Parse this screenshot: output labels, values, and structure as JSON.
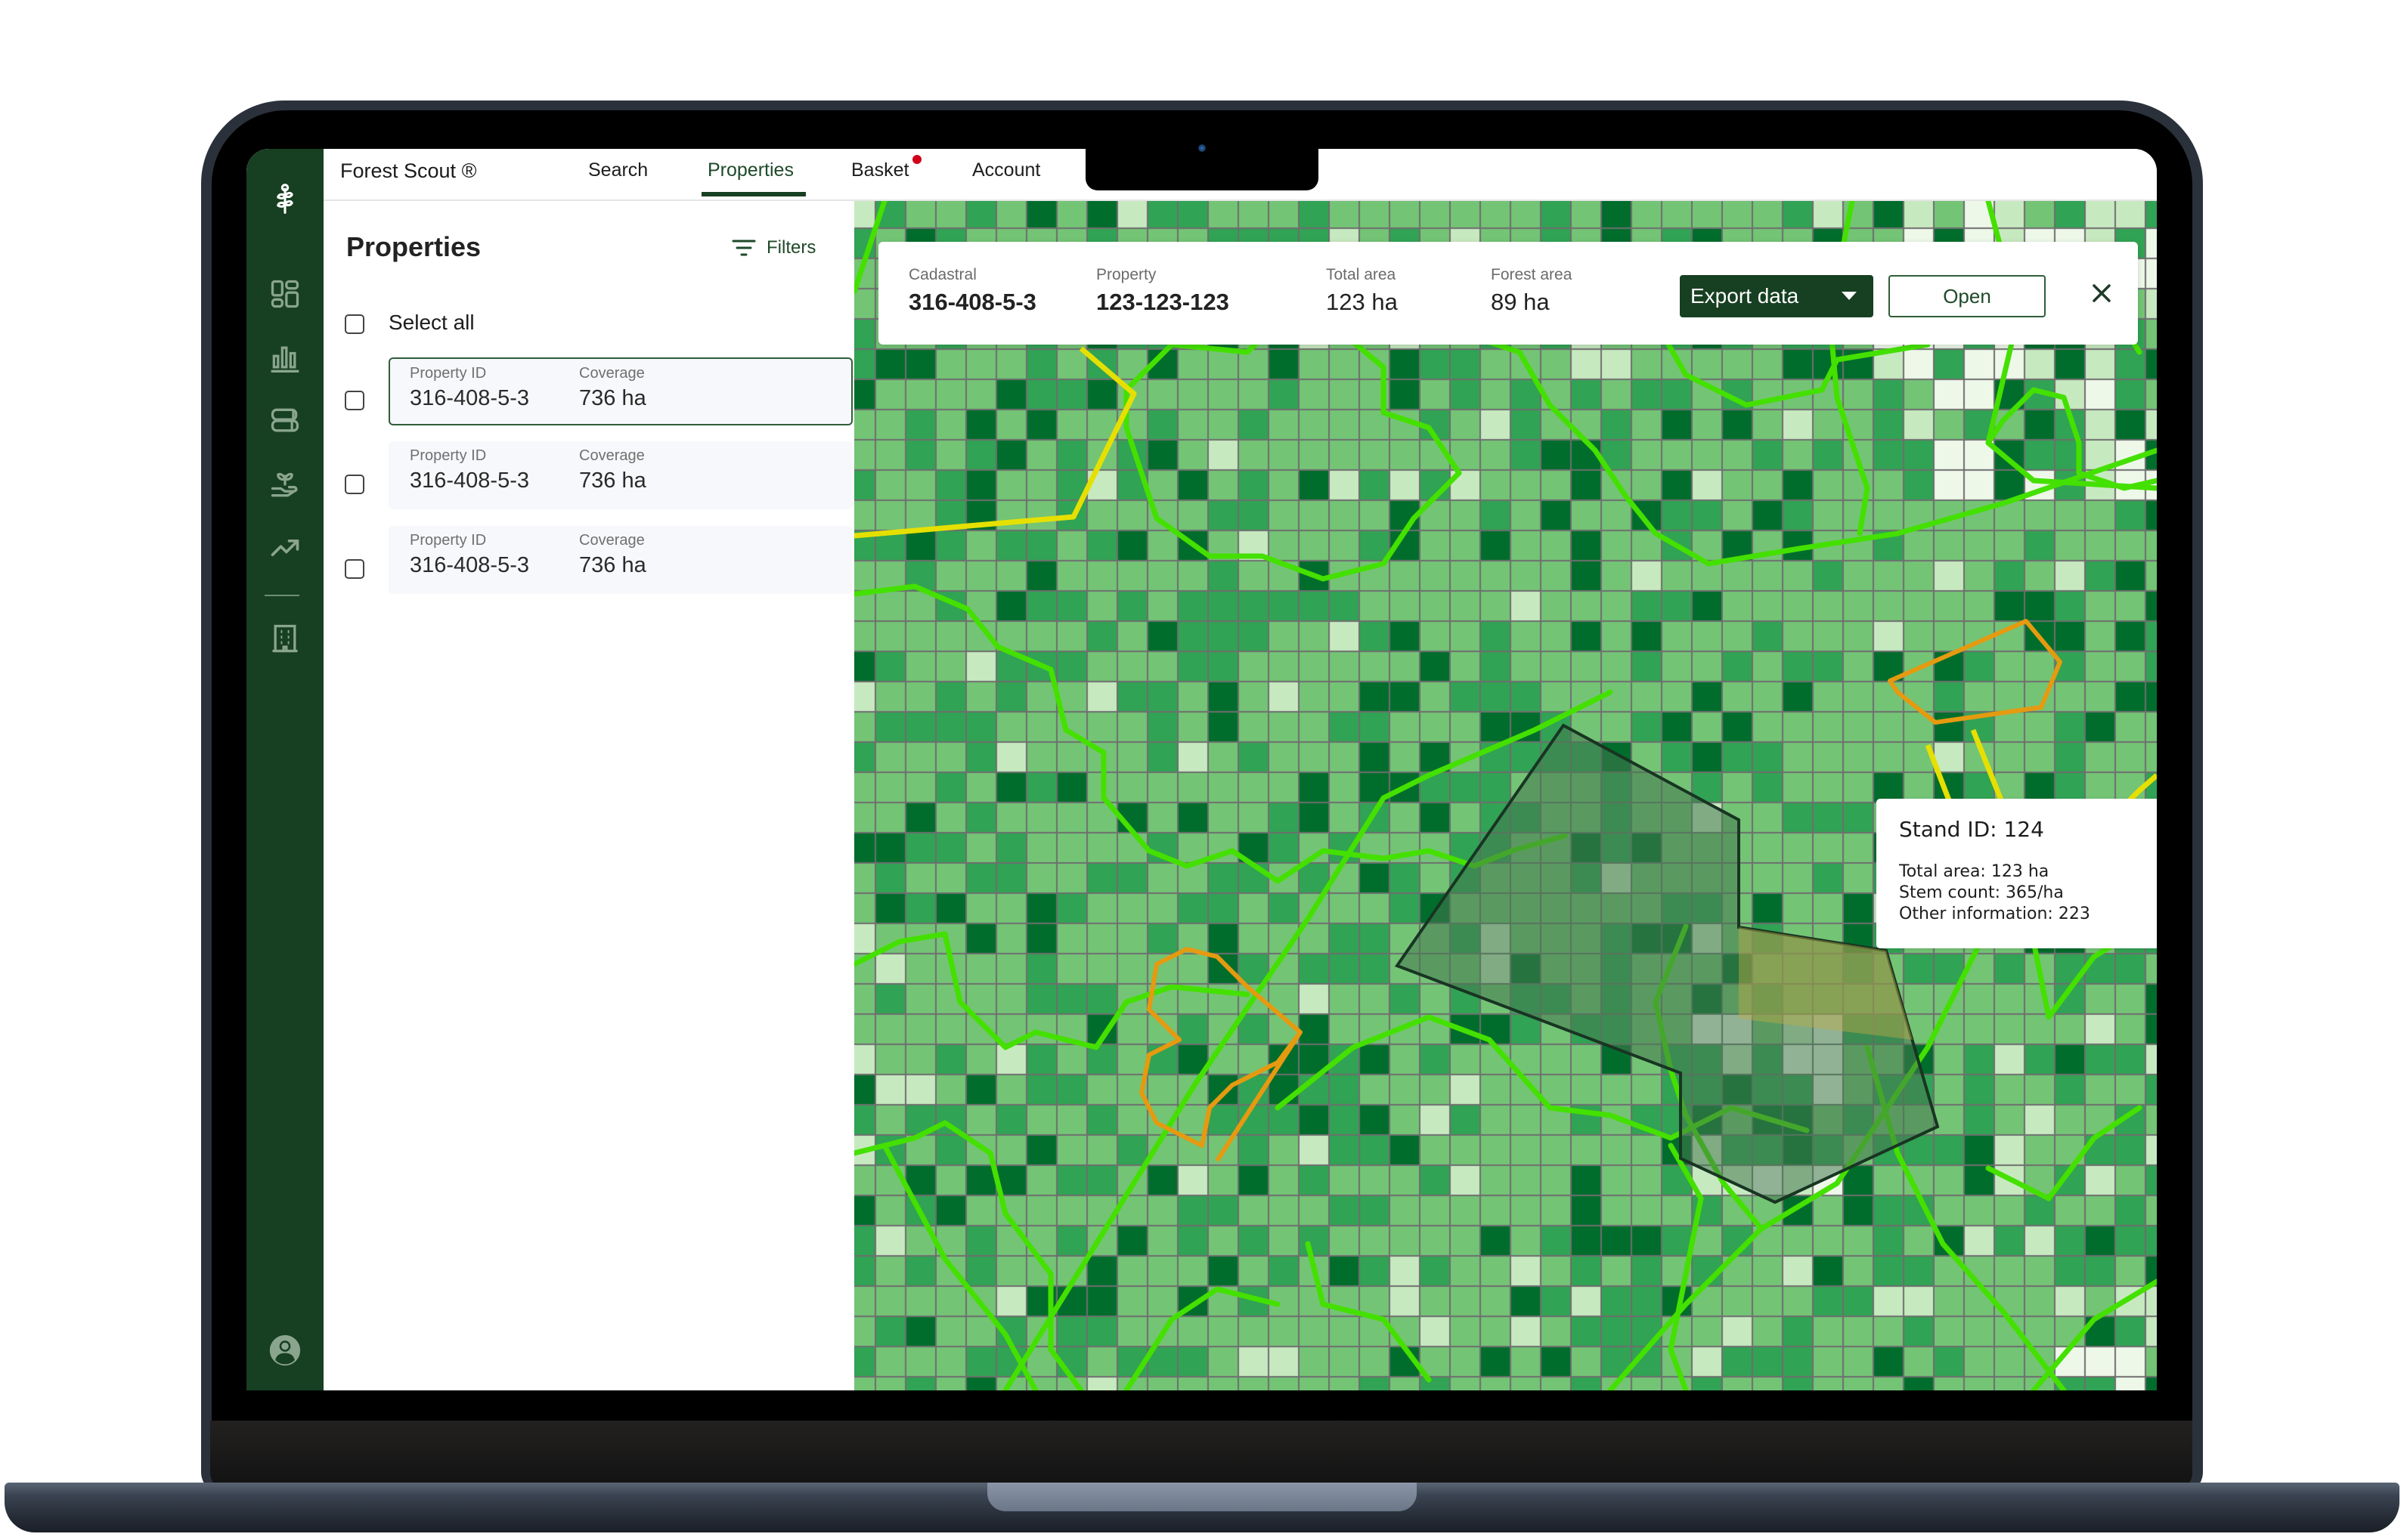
{
  "app": {
    "title": "Forest Scout ®",
    "brand_color": "#173f22",
    "accent_color": "#1f4a29",
    "notification_color": "#d0021b"
  },
  "nav": {
    "tabs": [
      {
        "label": "Search",
        "active": false
      },
      {
        "label": "Properties",
        "active": true
      },
      {
        "label": "Basket",
        "active": false,
        "has_notification": true
      },
      {
        "label": "Account",
        "active": false
      }
    ]
  },
  "sidebar": {
    "items": [
      {
        "icon": "plant-logo-icon"
      },
      {
        "icon": "dashboard-icon"
      },
      {
        "icon": "bar-chart-icon"
      },
      {
        "icon": "timber-logs-icon"
      },
      {
        "icon": "seedling-hand-icon"
      },
      {
        "icon": "trending-up-icon"
      },
      {
        "icon": "building-icon"
      },
      {
        "icon": "user-account-icon"
      }
    ]
  },
  "panel": {
    "title": "Properties",
    "filters_label": "Filters",
    "select_all_label": "Select all",
    "properties": [
      {
        "id_label": "Property ID",
        "id": "316-408-5-3",
        "coverage_label": "Coverage",
        "coverage": "736 ha",
        "selected": true,
        "checked": false
      },
      {
        "id_label": "Property ID",
        "id": "316-408-5-3",
        "coverage_label": "Coverage",
        "coverage": "736 ha",
        "selected": false,
        "checked": false
      },
      {
        "id_label": "Property ID",
        "id": "316-408-5-3",
        "coverage_label": "Coverage",
        "coverage": "736 ha",
        "selected": false,
        "checked": false
      }
    ]
  },
  "infobar": {
    "cadastral_label": "Cadastral",
    "cadastral": "316-408-5-3",
    "property_label": "Property",
    "property": "123-123-123",
    "total_area_label": "Total area",
    "total_area": "123 ha",
    "forest_area_label": "Forest area",
    "forest_area": "89 ha",
    "export_label": "Export data",
    "open_label": "Open"
  },
  "tooltip": {
    "title": "Stand ID: 124",
    "lines": [
      "Total area: 123 ha",
      "Stem count: 365/ha",
      "Other information: 223"
    ]
  },
  "map": {
    "density_palette": [
      "#edf8e9",
      "#c7e9c0",
      "#74c476",
      "#31a354",
      "#006d2c"
    ],
    "grid_line_color": "#6e6e6e",
    "boundary_colors": {
      "stand": "#44e000",
      "property": "#e6e000",
      "selected": "#e59a10"
    }
  }
}
